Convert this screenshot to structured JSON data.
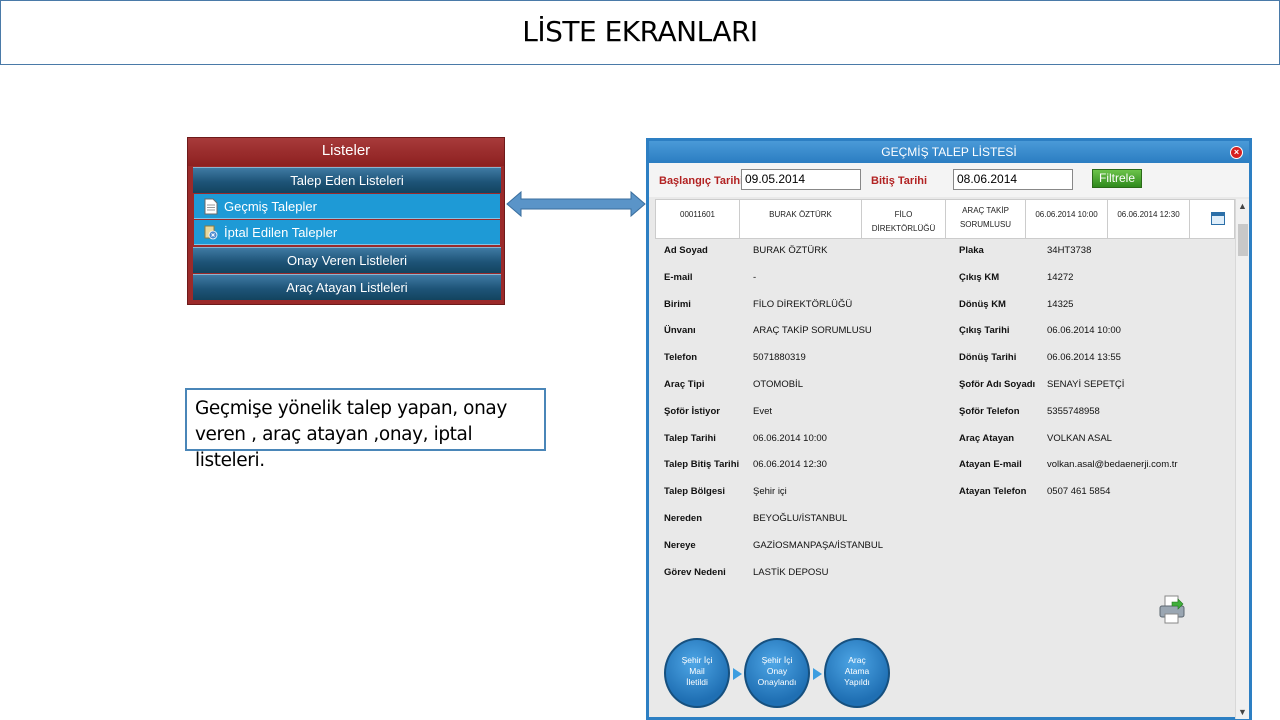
{
  "slide": {
    "title": "LİSTE EKRANLARI"
  },
  "menu": {
    "title": "Listeler",
    "bands": [
      "Talep Eden Listeleri",
      "Onay Veren Listleleri",
      "Araç Atayan Listleleri"
    ],
    "items": [
      {
        "label": "Geçmiş Talepler",
        "icon": "document-icon"
      },
      {
        "label": "İptal Edilen Talepler",
        "icon": "cancel-doc-icon"
      }
    ]
  },
  "note": {
    "line1": "Geçmişe yönelik talep yapan, onay",
    "line2": "veren , araç atayan ,onay, iptal listeleri."
  },
  "window": {
    "title": "GEÇMİŞ TALEP LİSTESİ",
    "filter": {
      "start_label": "Başlangıç Tarihi",
      "start_value": "09.05.2014",
      "end_label": "Bitiş Tarihi",
      "end_value": "08.06.2014",
      "button": "Filtrele"
    },
    "summary": [
      "00011601",
      "BURAK ÖZTÜRK",
      "FİLO DİREKTÖRLÜĞÜ",
      "ARAÇ TAKİP SORUMLUSU",
      "06.06.2014 10:00",
      "06.06.2014 12:30"
    ],
    "left_fields": [
      {
        "label": "Ad Soyad",
        "value": "BURAK ÖZTÜRK"
      },
      {
        "label": "E-mail",
        "value": "-"
      },
      {
        "label": "Birimi",
        "value": "FİLO DİREKTÖRLÜĞÜ"
      },
      {
        "label": "Ünvanı",
        "value": "ARAÇ TAKİP SORUMLUSU"
      },
      {
        "label": "Telefon",
        "value": "5071880319"
      },
      {
        "label": "Araç Tipi",
        "value": "OTOMOBİL"
      },
      {
        "label": "Şoför İstiyor",
        "value": "Evet"
      },
      {
        "label": "Talep Tarihi",
        "value": "06.06.2014 10:00"
      },
      {
        "label": "Talep Bitiş Tarihi",
        "value": "06.06.2014 12:30"
      },
      {
        "label": "Talep Bölgesi",
        "value": "Şehir içi"
      },
      {
        "label": "Nereden",
        "value": "BEYOĞLU/İSTANBUL"
      },
      {
        "label": "Nereye",
        "value": "GAZİOSMANPAŞA/İSTANBUL"
      },
      {
        "label": "Görev Nedeni",
        "value": "LASTİK DEPOSU"
      }
    ],
    "right_fields": [
      {
        "label": "Plaka",
        "value": "34HT3738"
      },
      {
        "label": "Çıkış KM",
        "value": "14272"
      },
      {
        "label": "Dönüş KM",
        "value": "14325"
      },
      {
        "label": "Çıkış Tarihi",
        "value": "06.06.2014 10:00"
      },
      {
        "label": "Dönüş Tarihi",
        "value": "06.06.2014 13:55"
      },
      {
        "label": "Şoför Adı Soyadı",
        "value": "SENAYİ SEPETÇİ"
      },
      {
        "label": "Şoför Telefon",
        "value": "5355748958"
      },
      {
        "label": "Araç Atayan",
        "value": "VOLKAN ASAL"
      },
      {
        "label": "Atayan E-mail",
        "value": "volkan.asal@bedaenerji.com.tr"
      },
      {
        "label": "Atayan Telefon",
        "value": "0507 461 5854"
      }
    ],
    "steps": [
      {
        "l1": "Şehir İçi",
        "l2": "Mail",
        "l3": "İletildi"
      },
      {
        "l1": "Şehir İçi",
        "l2": "Onay",
        "l3": "Onaylandı"
      },
      {
        "l1": "Araç",
        "l2": "Atama",
        "l3": "Yapıldı"
      }
    ]
  }
}
